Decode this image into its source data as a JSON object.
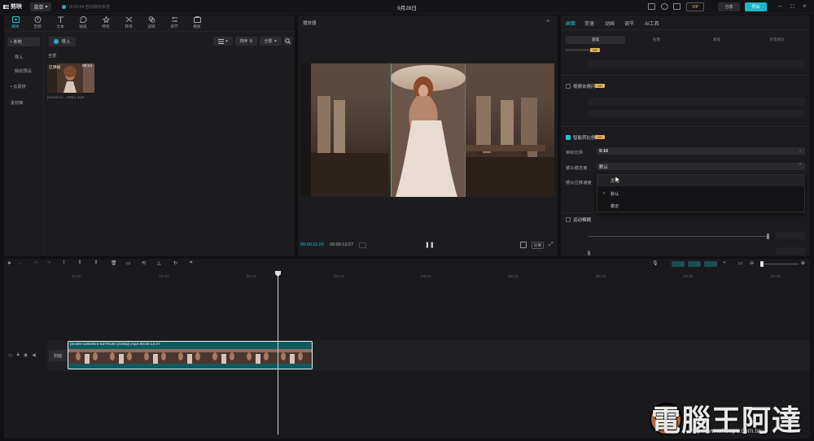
{
  "titlebar": {
    "app_name": "剪映",
    "menu_label": "菜单",
    "save_status": "16:53:54 自动保存本地",
    "doc_title": "9月28日",
    "vip_label": "VIP",
    "share_label": "分享",
    "export_label": "导出"
  },
  "media_panel": {
    "tabs": [
      "媒体",
      "音频",
      "文本",
      "贴纸",
      "特效",
      "转场",
      "滤镜",
      "调节",
      "模板"
    ],
    "sidebar": [
      "• 本地",
      "导入",
      "我的预设",
      "• 云素材",
      "素材库"
    ],
    "import_label": "导入",
    "sort_label": "排序",
    "filter_label": "全部",
    "section_label": "全部",
    "clip_badge": "已添加",
    "clip_duration": "00:14",
    "clip_name": "pexels-co...160p).mp4"
  },
  "player": {
    "title": "播放器",
    "current_time": "00:00:11:29",
    "total_time": "00:00:13:27",
    "ratio_label": "比例"
  },
  "props_panel": {
    "tabs": [
      "画面",
      "变速",
      "动画",
      "调节",
      "AI工具"
    ],
    "subtabs": [
      "基础",
      "抠像",
      "蒙版",
      "背景填充"
    ],
    "section_denoise": "视频去频闪",
    "section_smart_ratio": "智能转比例",
    "section_motion_blur": "运动模糊",
    "vip_badge": "VIP",
    "target_ratio_label": "目标比例",
    "target_ratio_value": "9:16",
    "stability_label": "镜头稳定度",
    "stability_value": "默认",
    "displacement_label": "镜头位移速度",
    "dropdown_options": [
      "灵动",
      "默认",
      "稳定"
    ],
    "dropdown_selected": "默认"
  },
  "timeline": {
    "ticks": [
      "00:00",
      "|00:05",
      "|00:10",
      "|00:15",
      "|00:20",
      "|00:25",
      "|00:30",
      "|00:35",
      "|00:40"
    ],
    "cover_label": "封面",
    "clip_label": "pexels-cottonbro-5379136 (2160p).mp4   00:00:13:27"
  },
  "watermark": {
    "text": "電腦王阿達",
    "url": "http://www.kocpc.com.tw"
  },
  "colors": {
    "accent": "#25c2d6",
    "panel": "#1c1c1f",
    "background": "#111113",
    "clip": "#0f5a5e",
    "vip_gold": "#e2b35a"
  }
}
